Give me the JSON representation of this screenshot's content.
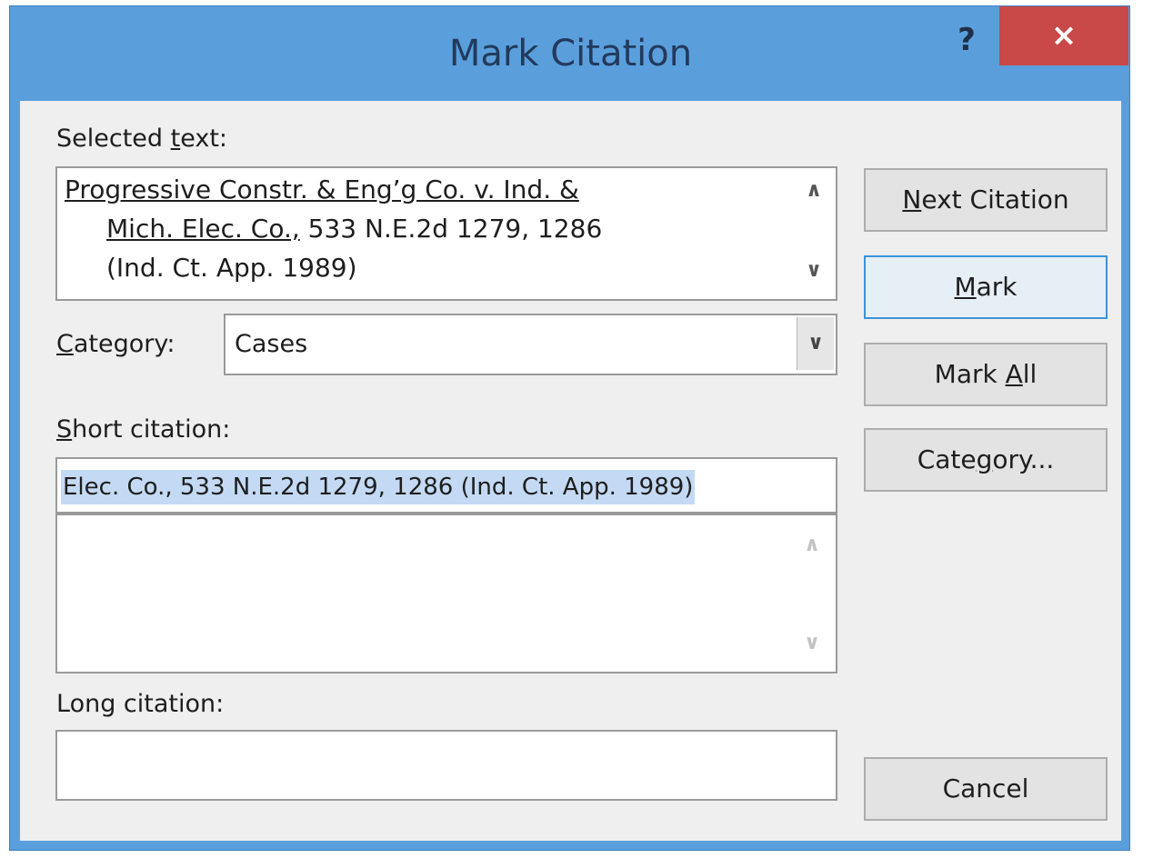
{
  "window": {
    "title": "Mark Citation",
    "help_label": "?",
    "close_label": "×"
  },
  "selected_text": {
    "label_before": "Selected ",
    "label_mnemonic": "t",
    "label_after": "ext:",
    "line1": "Progressive Constr. & Eng’g Co. v. Ind. &",
    "line2_underlined": "Mich. Elec. Co.,",
    "line2_rest": "  533 N.E.2d 1279, 1286",
    "line3": "(Ind. Ct. App. 1989)"
  },
  "category": {
    "label_mnemonic": "C",
    "label_after": "ategory:",
    "value": "Cases"
  },
  "short_citation": {
    "label_mnemonic": "S",
    "label_after": "hort citation:",
    "value": "Elec. Co.,  533 N.E.2d 1279, 1286 (Ind. Ct. App. 1989)"
  },
  "long_citation": {
    "label": "Long citation:",
    "value": ""
  },
  "buttons": {
    "next_citation": {
      "mnemonic": "N",
      "rest": "ext Citation"
    },
    "mark": {
      "mnemonic": "M",
      "rest": "ark"
    },
    "mark_all": {
      "before": "Mark ",
      "mnemonic": "A",
      "rest": "ll"
    },
    "category": {
      "before": "Cate",
      "mnemonic": "g",
      "rest": "ory..."
    },
    "cancel": {
      "label": "Cancel"
    }
  },
  "icons": {
    "scroll_up": "∧",
    "scroll_down": "∨",
    "dropdown": "∨"
  }
}
